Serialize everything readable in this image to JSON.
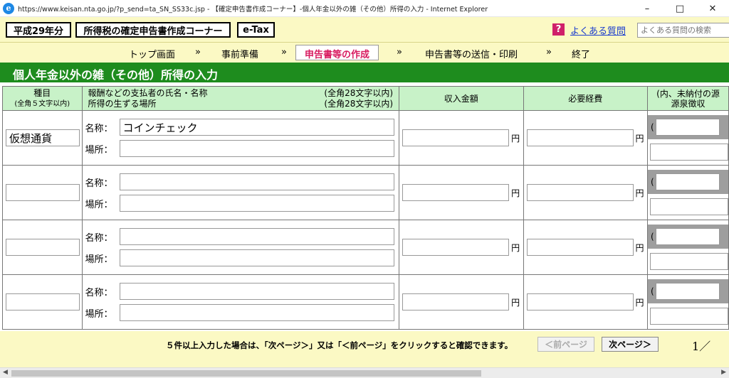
{
  "window": {
    "title": "https://www.keisan.nta.go.jp/?p_send=ta_SN_SS33c.jsp - 【確定申告書作成コーナー】-個人年金以外の雑（その他）所得の入力 - Internet Explorer",
    "minimize": "–",
    "maximize": "□",
    "close": "✕"
  },
  "header": {
    "year": "平成29年分",
    "corner": "所得税の確定申告書作成コーナー",
    "etax": "e-Tax",
    "faq_icon": "?",
    "faq_link": "よくある質問",
    "faq_search_placeholder": "よくある質問の検索"
  },
  "steps": [
    {
      "label": "トップ画面"
    },
    {
      "label": "事前準備"
    },
    {
      "label": "申告書等の作成"
    },
    {
      "label": "申告書等の送信・印刷"
    },
    {
      "label": "終了"
    }
  ],
  "arrow": "»",
  "section": {
    "title": "個人年金以外の雑（その他）所得の入力"
  },
  "table": {
    "headers": {
      "type": "種目",
      "type_note": "(全角５文字以内)",
      "payer_line1": "報酬などの支払者の氏名・名称",
      "payer_line1_note": "(全角28文字以内)",
      "payer_line2": "所得の生ずる場所",
      "payer_line2_note": "(全角28文字以内)",
      "income": "収入金額",
      "expense": "必要経費",
      "tax_line1": "(内、未納付の源",
      "tax_line2": "源泉徴収"
    },
    "labels": {
      "name": "名称：",
      "place": "場所：",
      "yen": "円",
      "paren": "("
    },
    "rows": [
      {
        "type": "仮想通貨",
        "name": "コインチェック",
        "place": "",
        "income": "",
        "expense": ""
      },
      {
        "type": "",
        "name": "",
        "place": "",
        "income": "",
        "expense": ""
      },
      {
        "type": "",
        "name": "",
        "place": "",
        "income": "",
        "expense": ""
      },
      {
        "type": "",
        "name": "",
        "place": "",
        "income": "",
        "expense": ""
      }
    ]
  },
  "footer": {
    "note": "５件以上入力した場合は、「次ページ＞」又は「＜前ページ」をクリックすると確認できます。",
    "prev": "＜前ページ",
    "next": "次ページ＞",
    "page": "1／"
  }
}
